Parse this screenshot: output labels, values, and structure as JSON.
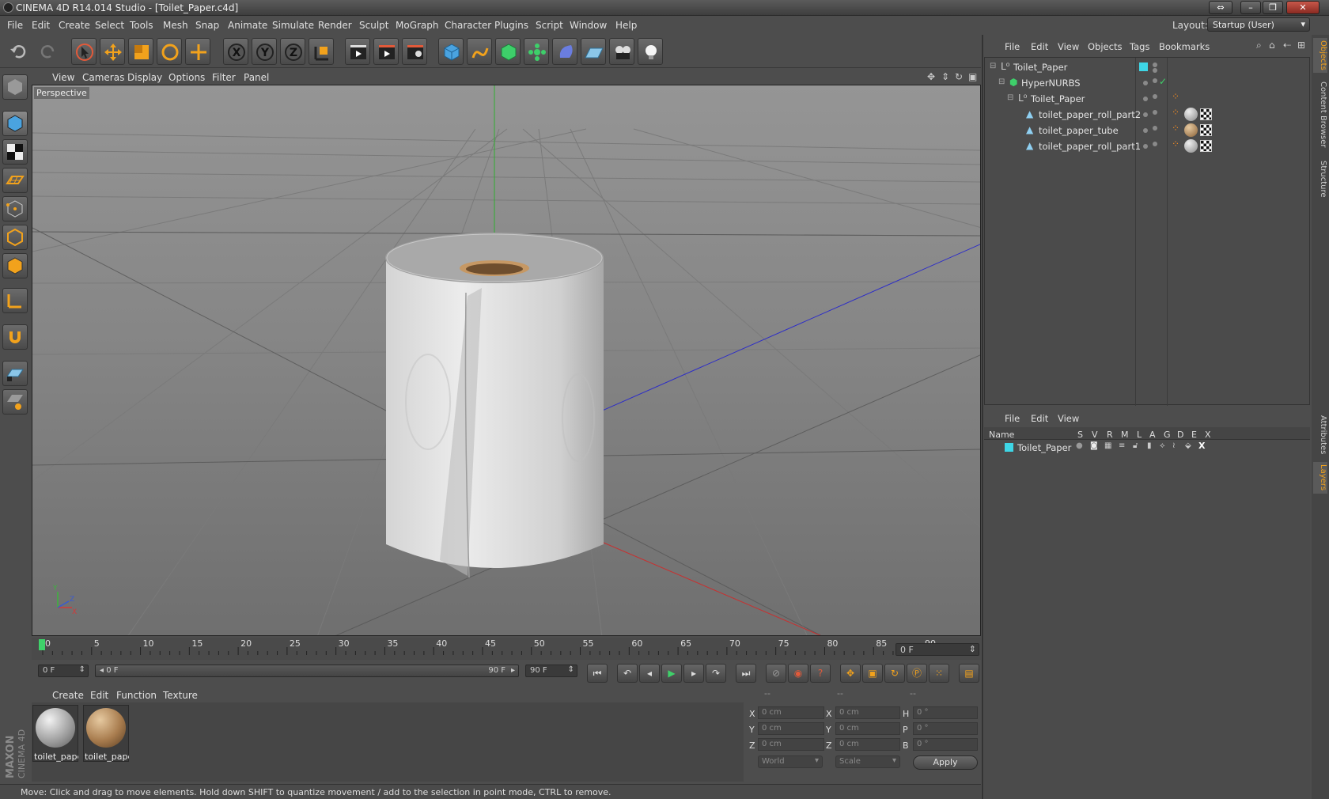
{
  "window": {
    "title": "CINEMA 4D R14.014 Studio - [Toilet_Paper.c4d]",
    "buttons": [
      "⇔",
      "–",
      "❐",
      "✕"
    ]
  },
  "menubar": [
    "File",
    "Edit",
    "Create",
    "Select",
    "Tools",
    "Mesh",
    "Snap",
    "Animate",
    "Simulate",
    "Render",
    "Sculpt",
    "MoGraph",
    "Character",
    "Plugins",
    "Script",
    "Window",
    "Help"
  ],
  "layout": {
    "label": "Layout:",
    "value": "Startup (User)"
  },
  "viewport": {
    "menu": [
      "View",
      "Cameras",
      "Display",
      "Options",
      "Filter",
      "Panel"
    ],
    "label": "Perspective",
    "axes": {
      "y": "Y",
      "z": "Z",
      "x": "X"
    }
  },
  "timeline": {
    "ticks": [
      "0",
      "5",
      "10",
      "15",
      "20",
      "25",
      "30",
      "35",
      "40",
      "45",
      "50",
      "55",
      "60",
      "65",
      "70",
      "75",
      "80",
      "85",
      "90"
    ],
    "current_frame": "0 F",
    "start_field": "0 F",
    "range_start": "0 F",
    "range_end": "90 F",
    "end_field": "90 F"
  },
  "materials": {
    "menu": [
      "Create",
      "Edit",
      "Function",
      "Texture"
    ],
    "items": [
      {
        "label": "toilet_paper",
        "color": "#bdbdbd"
      },
      {
        "label": "toilet_paper",
        "color": "#a87c4e"
      }
    ]
  },
  "coords": {
    "headers": [
      "--",
      "--",
      "--"
    ],
    "rows": [
      {
        "a": "X",
        "av": "0 cm",
        "b": "X",
        "bv": "0 cm",
        "c": "H",
        "cv": "0 °"
      },
      {
        "a": "Y",
        "av": "0 cm",
        "b": "Y",
        "bv": "0 cm",
        "c": "P",
        "cv": "0 °"
      },
      {
        "a": "Z",
        "av": "0 cm",
        "b": "Z",
        "bv": "0 cm",
        "c": "B",
        "cv": "0 °"
      }
    ],
    "mode1": "World",
    "mode2": "Scale",
    "apply": "Apply"
  },
  "status": "Move: Click and drag to move elements. Hold down SHIFT to quantize movement / add to the selection in point mode, CTRL to remove.",
  "object_manager": {
    "menu": [
      "File",
      "Edit",
      "View",
      "Objects",
      "Tags",
      "Bookmarks"
    ],
    "objects": [
      {
        "name": "Toilet_Paper",
        "indent": 0
      },
      {
        "name": "HyperNURBS",
        "indent": 1
      },
      {
        "name": "Toilet_Paper",
        "indent": 2
      },
      {
        "name": "toilet_paper_roll_part2",
        "indent": 3
      },
      {
        "name": "toilet_paper_tube",
        "indent": 3
      },
      {
        "name": "toilet_paper_roll_part1",
        "indent": 3
      }
    ]
  },
  "layer_manager": {
    "menu": [
      "File",
      "Edit",
      "View"
    ],
    "columns": [
      "Name",
      "S",
      "V",
      "R",
      "M",
      "L",
      "A",
      "G",
      "D",
      "E",
      "X"
    ],
    "layers": [
      {
        "name": "Toilet_Paper",
        "color": "#3ed6e6"
      }
    ]
  },
  "side_tabs": [
    "Objects",
    "Content Browser",
    "Structure",
    "Attributes",
    "Layers"
  ],
  "brand": {
    "maxon": "MAXON",
    "c4d": "CINEMA 4D"
  },
  "colors": {
    "accent": "#3ed6e6",
    "selection": "#f08a24"
  }
}
